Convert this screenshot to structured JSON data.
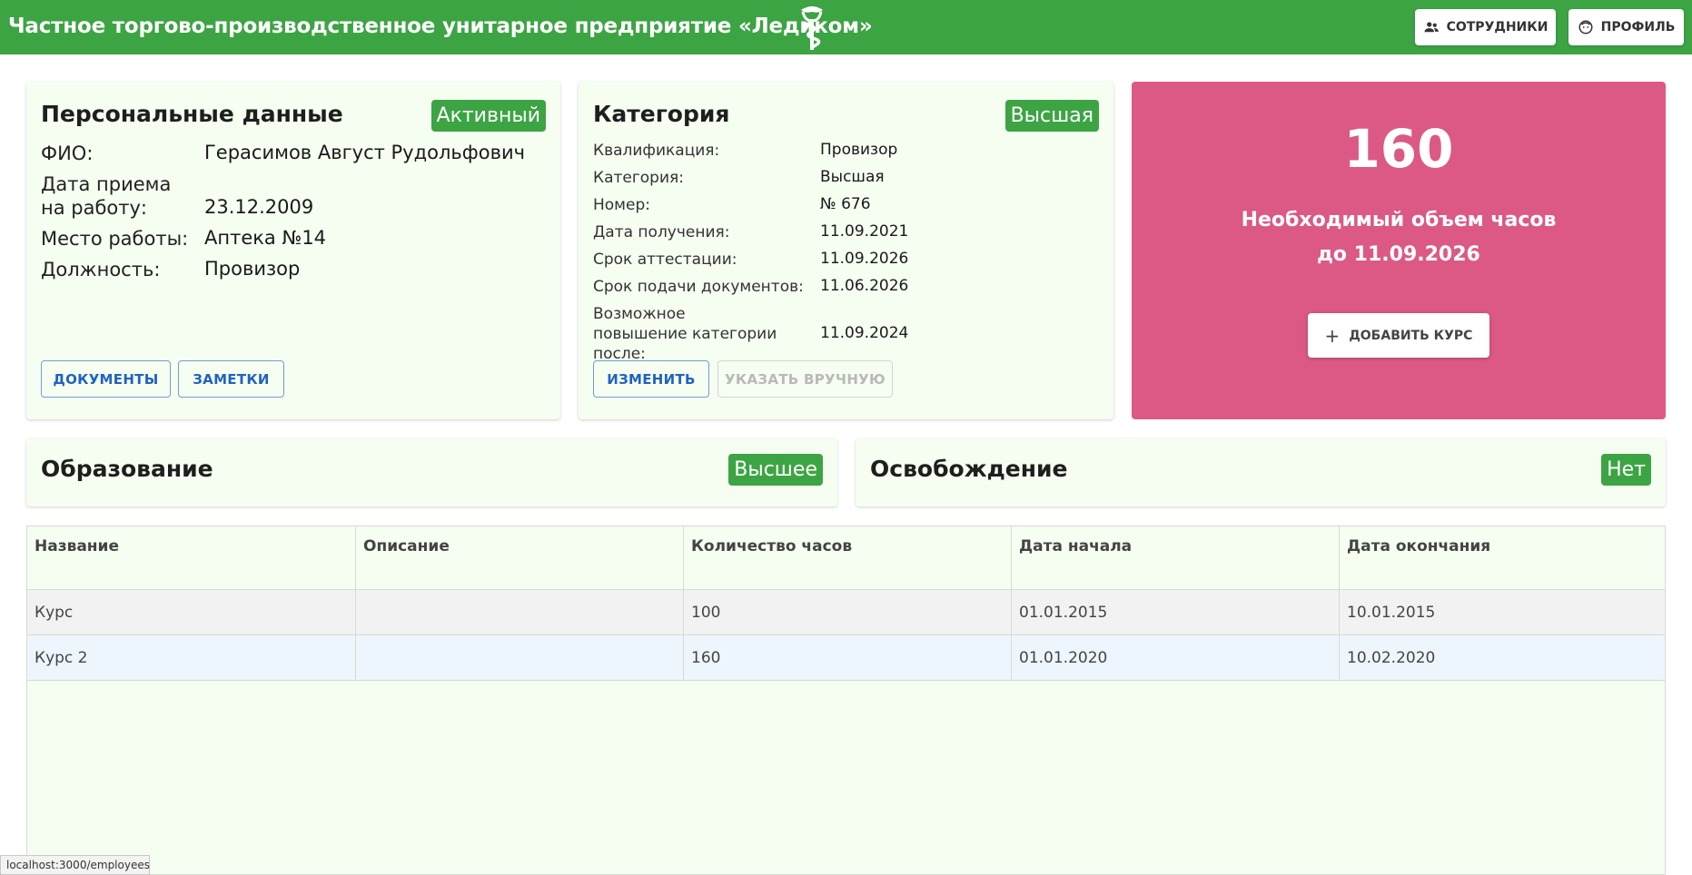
{
  "header": {
    "title": "Частное торгово-производственное унитарное предприятие «Ледиком»",
    "employees_label": "СОТРУДНИКИ",
    "profile_label": "ПРОФИЛЬ",
    "color": "#3da444"
  },
  "personal": {
    "title": "Персональные данные",
    "status": "Активный",
    "fields": [
      {
        "label": "ФИО:",
        "value": "Герасимов Август Рудольфович"
      },
      {
        "label": "Дата приема на работу:",
        "value": "23.12.2009"
      },
      {
        "label": "Место работы:",
        "value": "Аптека №14"
      },
      {
        "label": "Должность:",
        "value": "Провизор"
      }
    ],
    "documents_label": "ДОКУМЕНТЫ",
    "notes_label": "ЗАМЕТКИ"
  },
  "category": {
    "title": "Категория",
    "badge": "Высшая",
    "fields": [
      {
        "label": "Квалификация:",
        "value": "Провизор"
      },
      {
        "label": "Категория:",
        "value": "Высшая"
      },
      {
        "label": "Номер:",
        "value": "№ 676"
      },
      {
        "label": "Дата получения:",
        "value": "11.09.2021"
      },
      {
        "label": "Срок аттестации:",
        "value": "11.09.2026"
      },
      {
        "label": "Срок подачи документов:",
        "value": "11.06.2026"
      },
      {
        "label": "Возможное повышение категории после:",
        "value": "11.09.2024"
      }
    ],
    "edit_label": "ИЗМЕНИТЬ",
    "manual_label": "УКАЗАТЬ ВРУЧНУЮ"
  },
  "hours": {
    "value": "160",
    "line1": "Необходимый объем часов",
    "line2": "до 11.09.2026",
    "add_label": "ДОБАВИТЬ КУРС",
    "color": "#dc5985"
  },
  "education": {
    "title": "Образование",
    "badge": "Высшее"
  },
  "exemption": {
    "title": "Освобождение",
    "badge": "Нет"
  },
  "table": {
    "columns": [
      "Название",
      "Описание",
      "Количество часов",
      "Дата начала",
      "Дата окончания"
    ],
    "rows": [
      [
        "Курс",
        "",
        "100",
        "01.01.2015",
        "10.01.2015"
      ],
      [
        "Курс 2",
        "",
        "160",
        "01.01.2020",
        "10.02.2020"
      ]
    ]
  },
  "statusbar": {
    "url": "localhost:3000/employees"
  }
}
